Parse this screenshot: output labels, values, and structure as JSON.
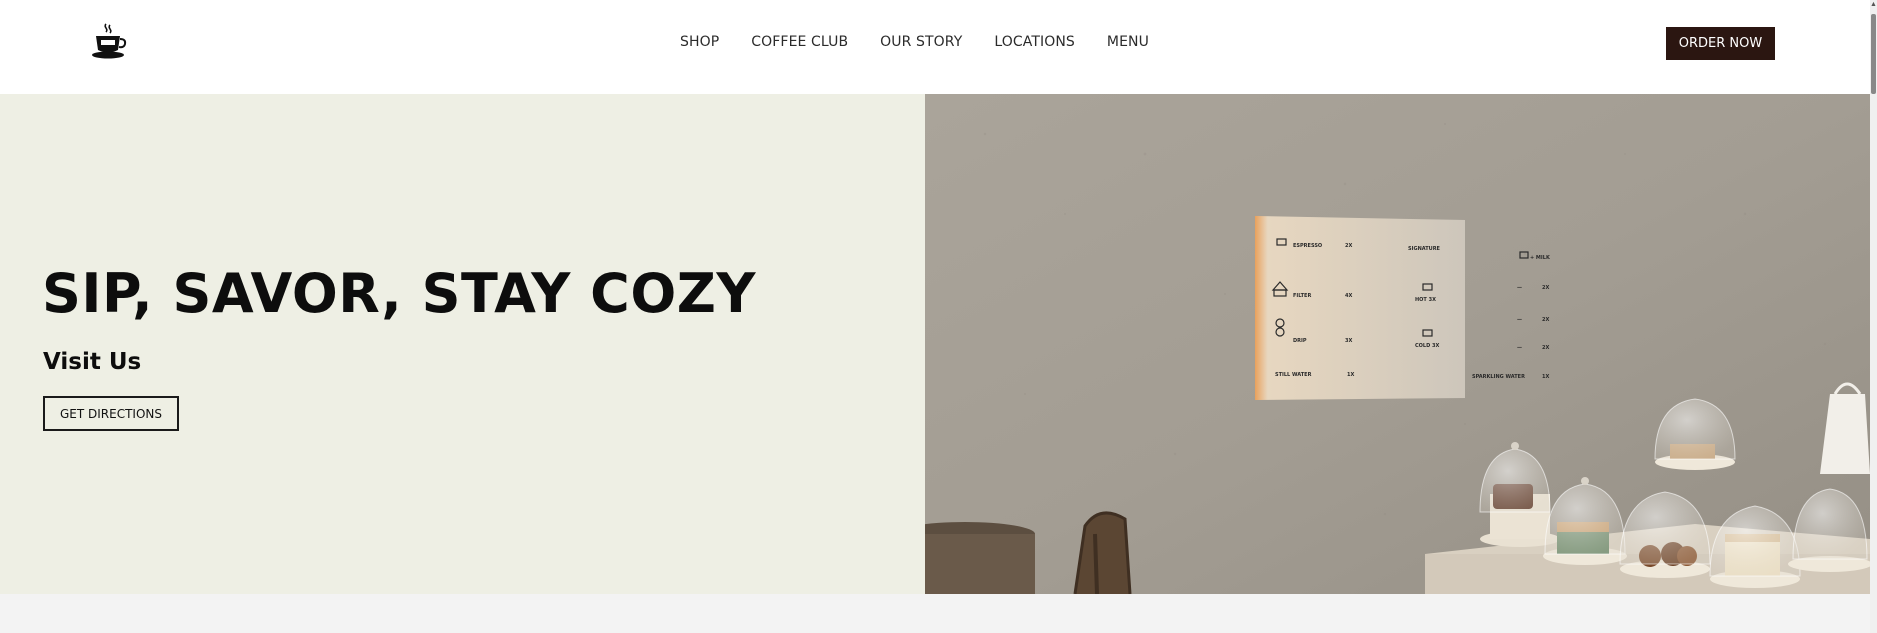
{
  "header": {
    "logo_icon": "coffee-cup-icon",
    "nav": [
      {
        "label": "SHOP"
      },
      {
        "label": "COFFEE CLUB"
      },
      {
        "label": "OUR STORY"
      },
      {
        "label": "LOCATIONS"
      },
      {
        "label": "MENU"
      }
    ],
    "order_button": "ORDER NOW"
  },
  "hero": {
    "title": "SIP, SAVOR, STAY COZY",
    "subtitle": "Visit Us",
    "button": "GET DIRECTIONS",
    "image": {
      "description_icon": "cafe-interior-photo",
      "menu_board": {
        "rows": [
          {
            "left": "ESPRESSO",
            "left_price": "2X",
            "mid": "SIGNATURE",
            "right": "+ MILK"
          },
          {
            "left": "FILTER",
            "left_price": "4X",
            "mid": "HOT 3X",
            "right": ""
          },
          {
            "left": "DRIP",
            "left_price": "3X",
            "mid": "COLD 3X",
            "right": ""
          },
          {
            "left": "STILL WATER",
            "left_price": "1X",
            "mid": "",
            "right": "SPARKLING WATER"
          }
        ]
      }
    }
  },
  "colors": {
    "hero_left_bg": "#eeefe4",
    "order_button_bg": "#2b1611",
    "header_bg": "#ffffff"
  }
}
